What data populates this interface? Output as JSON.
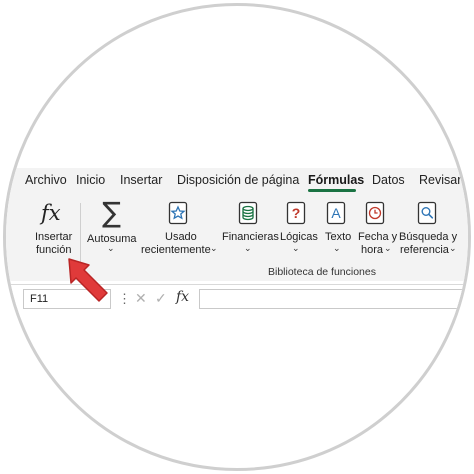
{
  "tabs": [
    {
      "label": "Archivo"
    },
    {
      "label": "Inicio"
    },
    {
      "label": "Insertar"
    },
    {
      "label": "Disposición de página"
    },
    {
      "label": "Fórmulas",
      "active": true
    },
    {
      "label": "Datos"
    },
    {
      "label": "Revisar"
    }
  ],
  "ribbon": {
    "insert_function": {
      "glyph": "fx",
      "line1": "Insertar",
      "line2": "función"
    },
    "autosum": {
      "glyph": "∑",
      "label": "Autosuma"
    },
    "recent": {
      "line1": "Usado",
      "line2": "recientemente"
    },
    "financial": {
      "label": "Financieras"
    },
    "logical": {
      "label": "Lógicas"
    },
    "text": {
      "label": "Texto"
    },
    "datetime": {
      "line1": "Fecha y",
      "line2": "hora"
    },
    "lookup": {
      "line1": "Búsqueda y",
      "line2": "referencia"
    },
    "chevron": "⌄",
    "group_label": "Biblioteca de funciones"
  },
  "formula_bar": {
    "name_box": "F11",
    "dots": "⋮",
    "cancel": "✕",
    "enter": "✓",
    "fx": "fx",
    "formula": ""
  },
  "colors": {
    "accent": "#1a7343",
    "arrow": "#e03a3a",
    "icon_blue": "#2e75b6",
    "icon_red": "#c0392b",
    "icon_green": "#1a7343"
  }
}
